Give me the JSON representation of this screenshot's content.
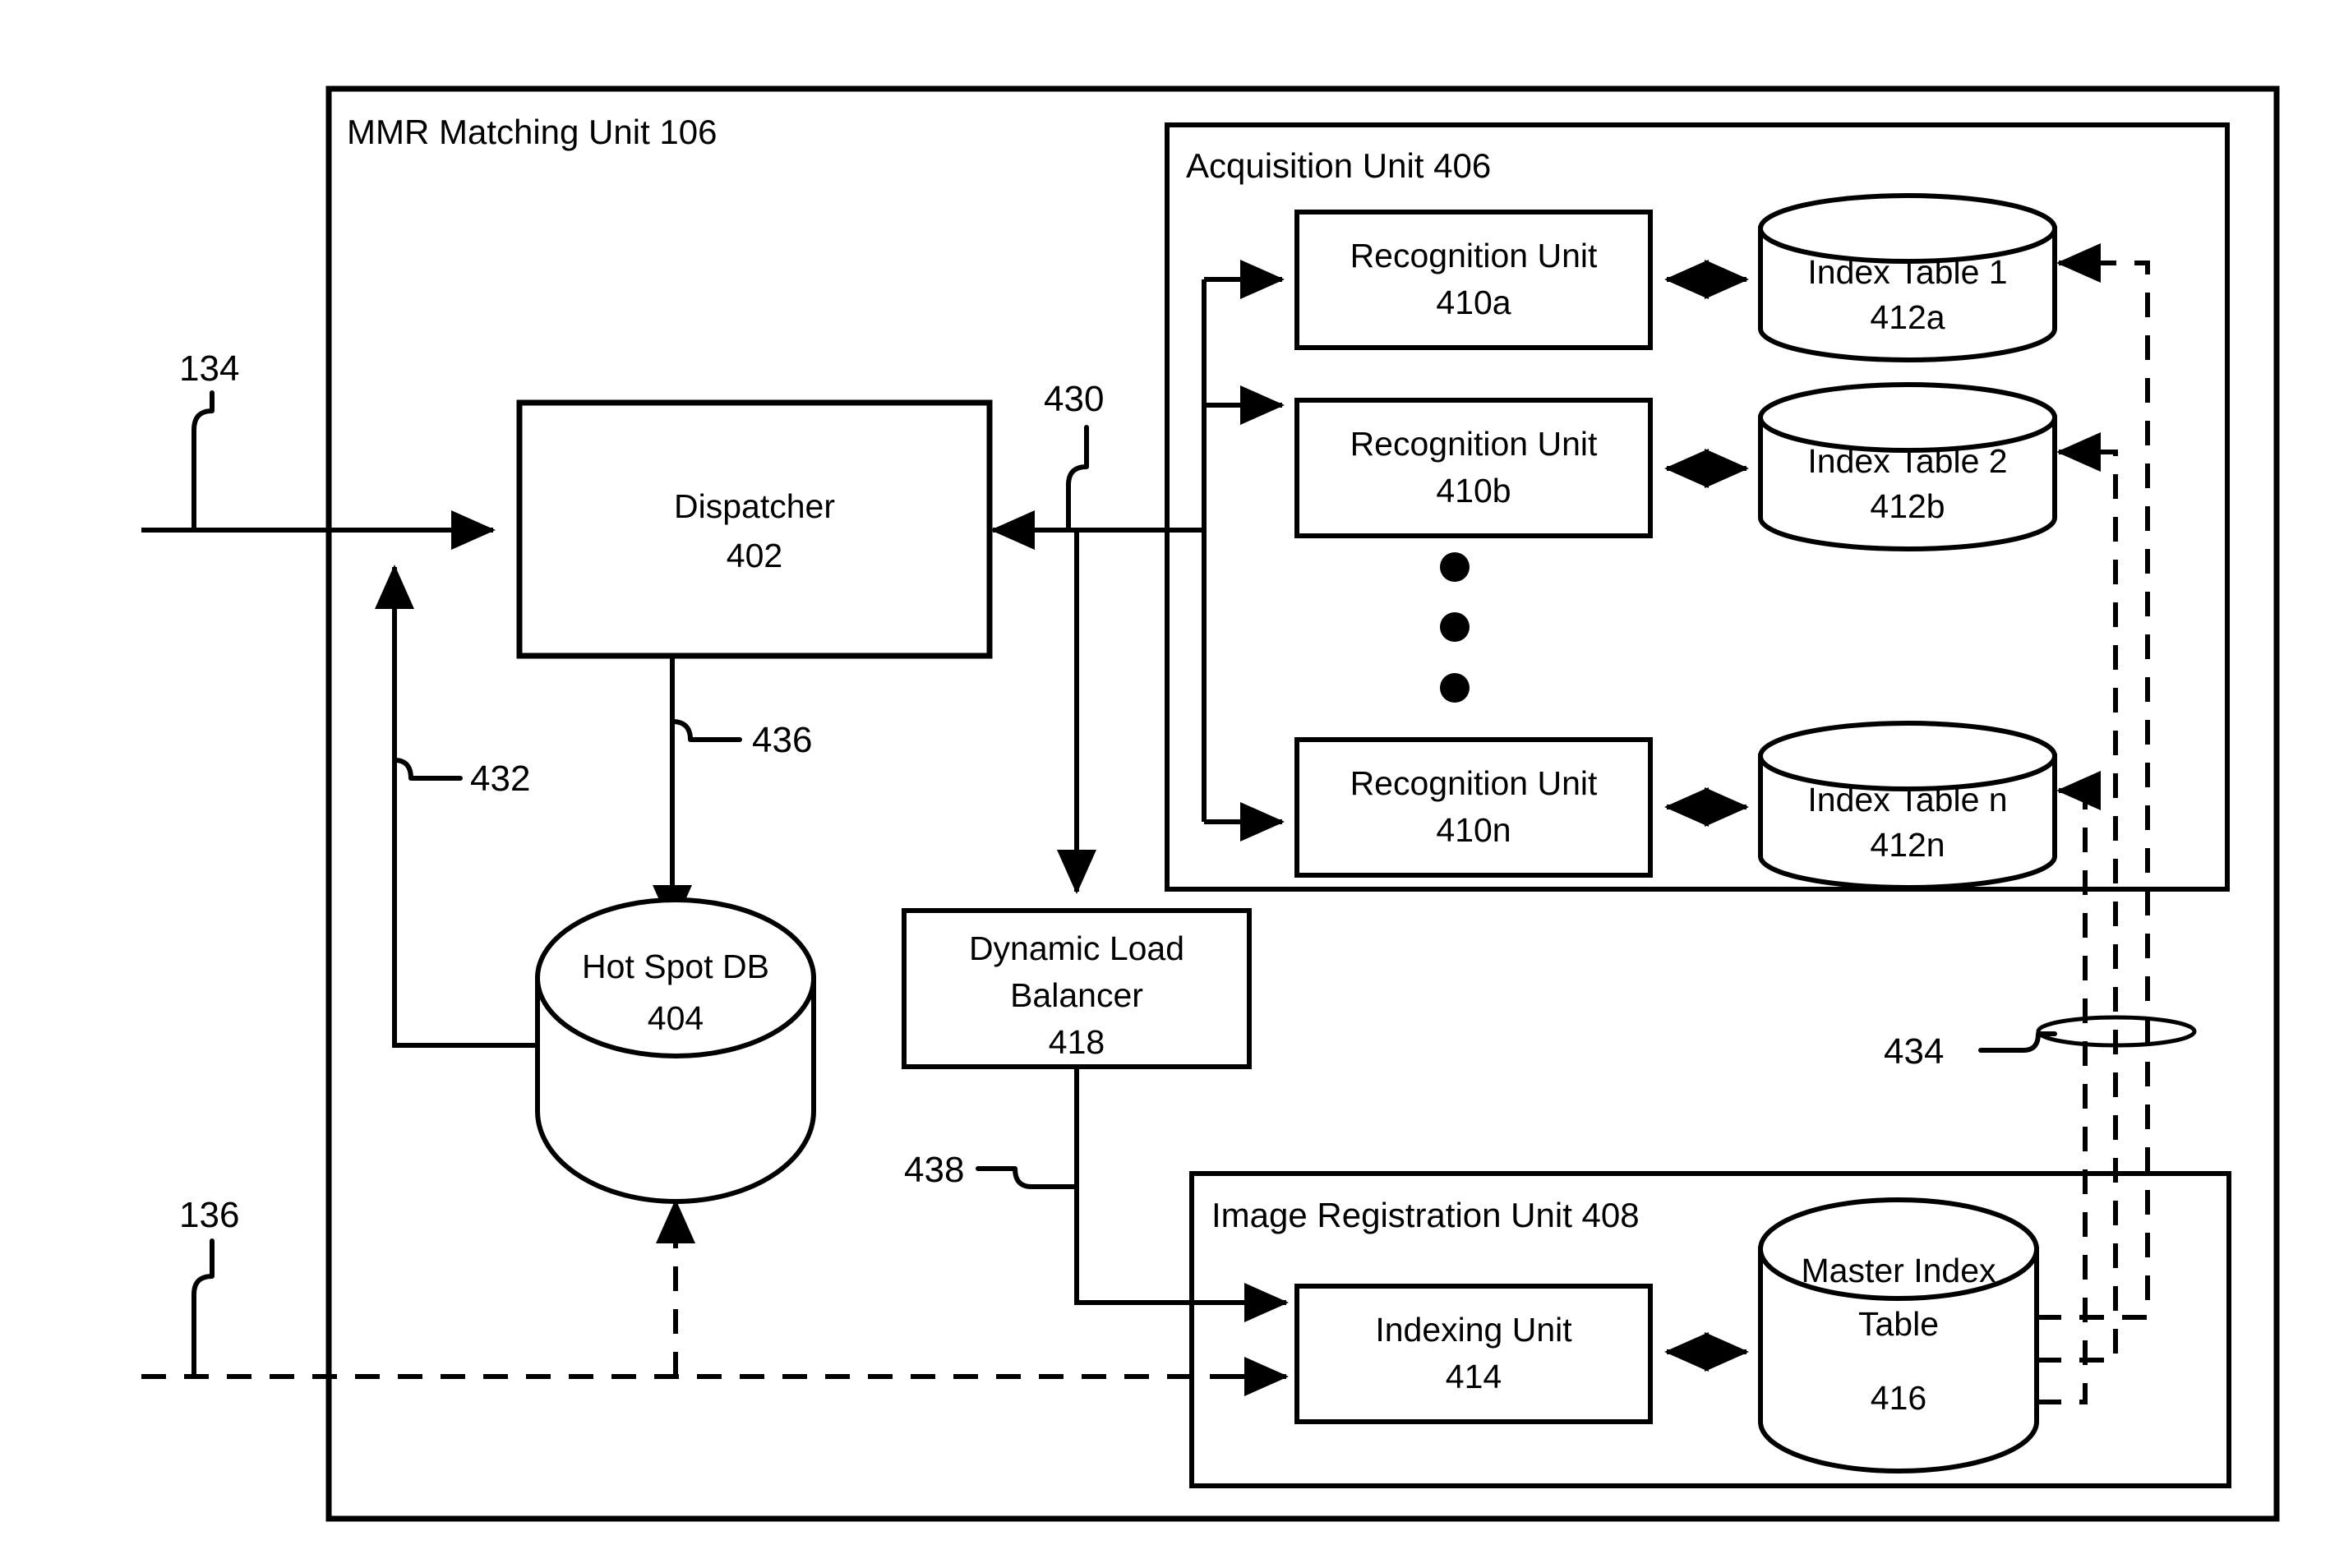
{
  "figure": {
    "outer_unit": {
      "label": "MMR Matching Unit 106"
    },
    "acquisition_unit": {
      "label": "Acquisition Unit 406"
    },
    "image_registration_unit": {
      "label": "Image Registration Unit 408"
    },
    "blocks": {
      "dispatcher": {
        "line1": "Dispatcher",
        "line2": "402"
      },
      "dynamic_load_balancer": {
        "line1": "Dynamic Load",
        "line2": "Balancer",
        "line3": "418"
      },
      "indexing_unit": {
        "line1": "Indexing Unit",
        "line2": "414"
      },
      "recognition_unit_a": {
        "line1": "Recognition Unit",
        "line2": "410a"
      },
      "recognition_unit_b": {
        "line1": "Recognition Unit",
        "line2": "410b"
      },
      "recognition_unit_n": {
        "line1": "Recognition Unit",
        "line2": "410n"
      }
    },
    "databases": {
      "hot_spot_db": {
        "line1": "Hot Spot DB",
        "line2": "404"
      },
      "index_table_1": {
        "line1": "Index Table 1",
        "line2": "412a"
      },
      "index_table_2": {
        "line1": "Index Table 2",
        "line2": "412b"
      },
      "index_table_n": {
        "line1": "Index Table n",
        "line2": "412n"
      },
      "master_index_table": {
        "line1": "Master Index",
        "line2": "Table",
        "line3": "416"
      }
    },
    "reference_numerals": {
      "input_134": "134",
      "input_136": "136",
      "signal_430": "430",
      "signal_432": "432",
      "signal_434": "434",
      "signal_436": "436",
      "signal_438": "438"
    },
    "ellipsis": {
      "dots_count": 3,
      "meaning": "vertical-ellipsis"
    },
    "colors": {
      "line": "#000000",
      "background": "#ffffff"
    }
  }
}
